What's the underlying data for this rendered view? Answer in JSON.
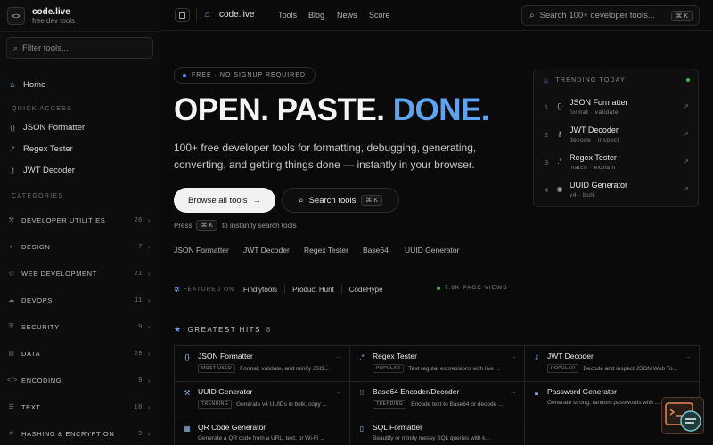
{
  "brand": {
    "name": "code.live",
    "tagline": "free dev tools"
  },
  "sidebar": {
    "filter_placeholder": "Filter tools...",
    "home": "Home",
    "quick_access_label": "QUICK ACCESS",
    "quick_access": [
      {
        "label": "JSON Formatter",
        "icon": "braces-icon"
      },
      {
        "label": "Regex Tester",
        "icon": "regex-icon"
      },
      {
        "label": "JWT Decoder",
        "icon": "key-icon"
      }
    ],
    "categories_label": "CATEGORIES",
    "categories": [
      {
        "label": "DEVELOPER UTILITIES",
        "count": "26"
      },
      {
        "label": "DESIGN",
        "count": "7"
      },
      {
        "label": "WEB DEVELOPMENT",
        "count": "21"
      },
      {
        "label": "DEVOPS",
        "count": "11"
      },
      {
        "label": "SECURITY",
        "count": "9"
      },
      {
        "label": "DATA",
        "count": "29"
      },
      {
        "label": "ENCODING",
        "count": "9"
      },
      {
        "label": "TEXT",
        "count": "18"
      },
      {
        "label": "HASHING & ENCRYPTION",
        "count": "9"
      }
    ]
  },
  "topbar": {
    "breadcrumb": "code.live",
    "nav": [
      "Tools",
      "Blog",
      "News",
      "Score"
    ],
    "search_placeholder": "Search 100+ developer tools...",
    "search_shortcut": "⌘ K"
  },
  "hero": {
    "badge": "FREE · NO SIGNUP REQUIRED",
    "title_main": "OPEN. PASTE. ",
    "title_accent": "DONE.",
    "description": "100+ free developer tools for formatting, debugging, generating, converting, and getting things done — instantly in your browser.",
    "primary_button": "Browse all tools",
    "secondary_button": "Search tools",
    "secondary_shortcut": "⌘ K",
    "hint_prefix": "Press",
    "hint_key": "⌘ K",
    "hint_suffix": "to instantly search tools",
    "quick_links": [
      "JSON Formatter",
      "JWT Decoder",
      "Regex Tester",
      "Base64",
      "UUID Generator"
    ]
  },
  "featured": {
    "label": "FEATURED ON",
    "sites": [
      "Findlytools",
      "Product Hunt",
      "CodeHype"
    ],
    "views": "7.8K PAGE VIEWS"
  },
  "trending": {
    "title": "TRENDING TODAY",
    "items": [
      {
        "rank": "1",
        "name": "JSON Formatter",
        "tags": "format · validate",
        "icon": "braces-icon"
      },
      {
        "rank": "2",
        "name": "JWT Decoder",
        "tags": "decode · inspect",
        "icon": "key-icon"
      },
      {
        "rank": "3",
        "name": "Regex Tester",
        "tags": "match · explain",
        "icon": "regex-icon"
      },
      {
        "rank": "4",
        "name": "UUID Generator",
        "tags": "v4 · bulk",
        "icon": "fingerprint-icon"
      }
    ]
  },
  "greatest_hits": {
    "title": "GREATEST HITS",
    "count": "8",
    "tools": [
      {
        "name": "JSON Formatter",
        "tag": "MOST USED",
        "desc": "Format, validate, and minify JSO...",
        "icon": "braces-icon"
      },
      {
        "name": "Regex Tester",
        "tag": "POPULAR",
        "desc": "Test regular expressions with live ...",
        "icon": "regex-icon"
      },
      {
        "name": "JWT Decoder",
        "tag": "POPULAR",
        "desc": "Decode and inspect JSON Web To...",
        "icon": "key-icon"
      },
      {
        "name": "UUID Generator",
        "tag": "TRENDING",
        "desc": "Generate v4 UUIDs in bulk, copy ...",
        "icon": "wrench-icon"
      },
      {
        "name": "Base64 Encoder/Decoder",
        "tag": "TRENDING",
        "desc": "Encode text to Base64 or decode ...",
        "icon": "grid-icon"
      },
      {
        "name": "Password Generator",
        "tag": "",
        "desc": "Generate strong, random passwords with ...",
        "icon": "lock-icon"
      },
      {
        "name": "QR Code Generator",
        "tag": "",
        "desc": "Generate a QR code from a URL, text, or Wi-Fi ...",
        "icon": "qr-icon"
      },
      {
        "name": "SQL Formatter",
        "tag": "",
        "desc": "Beautify or minify messy SQL queries with k...",
        "icon": "file-icon"
      }
    ]
  },
  "colors": {
    "accent": "#5ea2f2",
    "live": "#4caf50",
    "background": "#0a0a0a"
  }
}
